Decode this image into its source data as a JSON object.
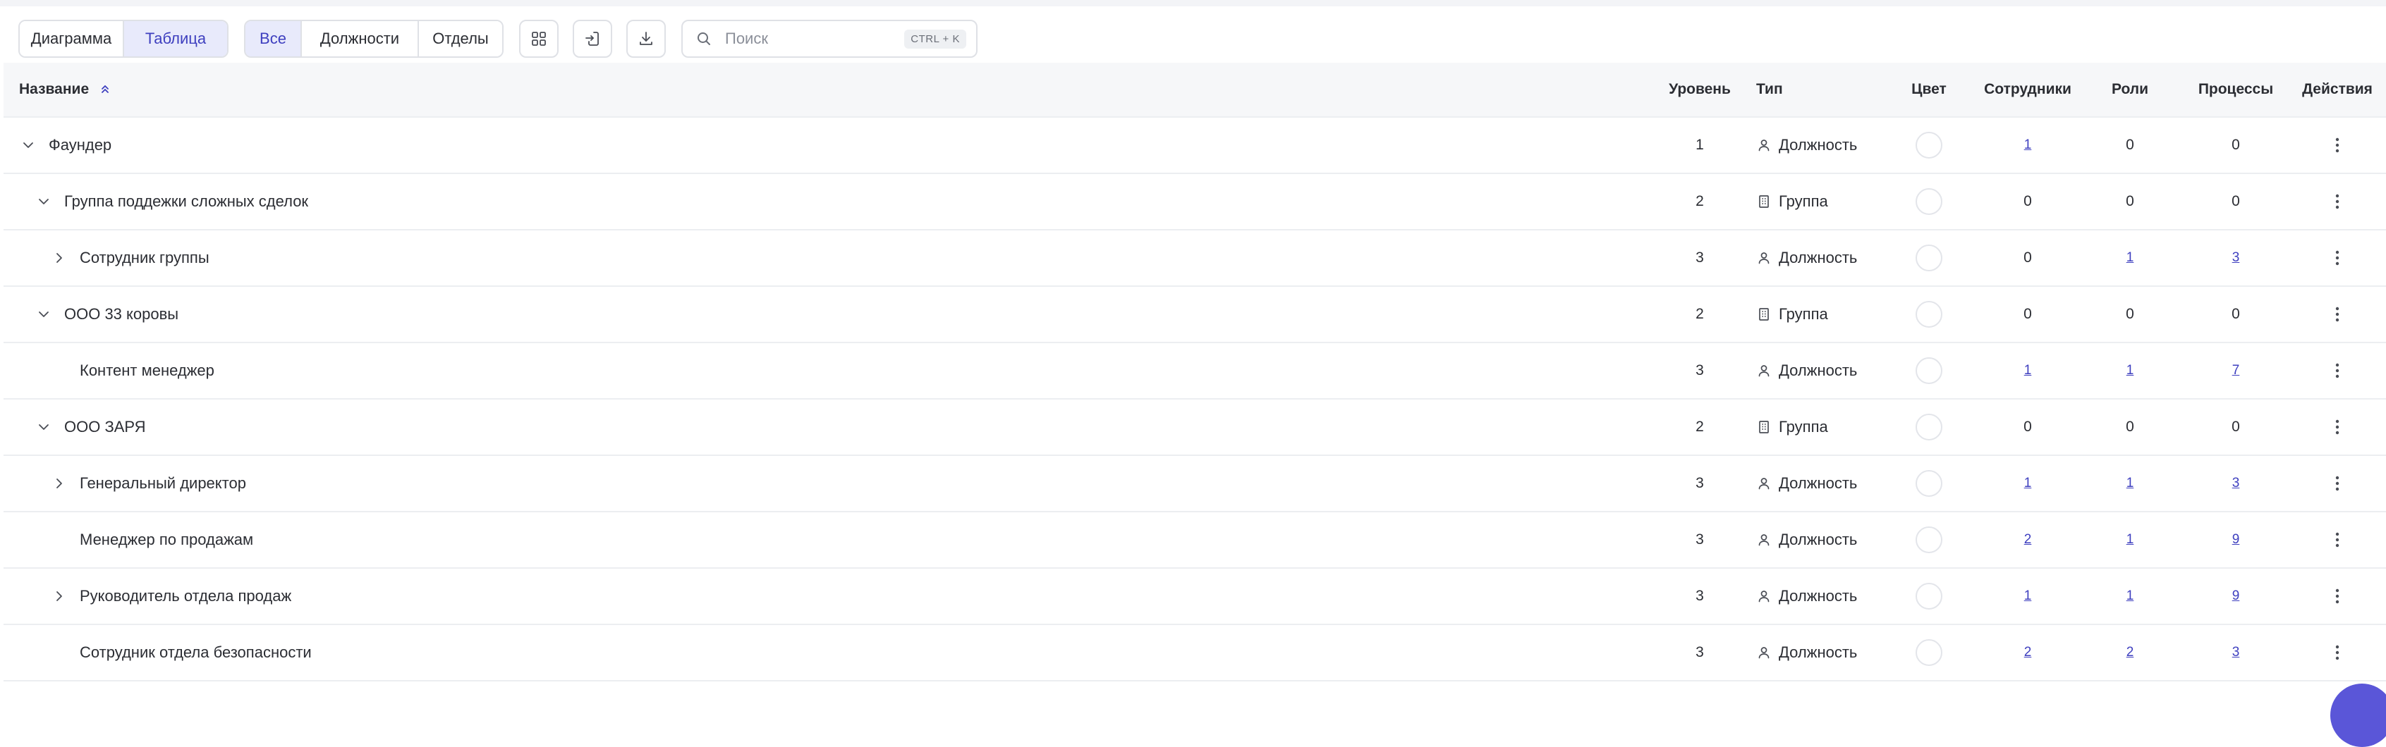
{
  "toolbar": {
    "view_tabs": [
      {
        "label": "Диаграмма",
        "active": false
      },
      {
        "label": "Таблица",
        "active": true
      }
    ],
    "filter_tabs": [
      {
        "label": "Все",
        "active": true
      },
      {
        "label": "Должности",
        "active": false
      },
      {
        "label": "Отделы",
        "active": false
      }
    ],
    "icon_buttons": [
      "grid-icon",
      "import-icon",
      "download-icon"
    ],
    "search": {
      "placeholder": "Поиск",
      "value": "",
      "shortcut": "CTRL + K"
    }
  },
  "table": {
    "columns": {
      "name": "Название",
      "level": "Уровень",
      "type": "Тип",
      "color": "Цвет",
      "employees": "Сотрудники",
      "roles": "Роли",
      "processes": "Процессы",
      "actions": "Действия"
    },
    "sort": {
      "column": "name",
      "direction": "asc"
    },
    "rows": [
      {
        "name": "Фаундер",
        "indent": 0,
        "toggle": "expanded",
        "level": "1",
        "type": "Должность",
        "type_icon": "person-icon",
        "employees": "1",
        "employees_link": true,
        "roles": "0",
        "roles_link": false,
        "processes": "0",
        "processes_link": false
      },
      {
        "name": "Группа поддежки сложных сделок",
        "indent": 1,
        "toggle": "expanded",
        "level": "2",
        "type": "Группа",
        "type_icon": "building-icon",
        "employees": "0",
        "employees_link": false,
        "roles": "0",
        "roles_link": false,
        "processes": "0",
        "processes_link": false
      },
      {
        "name": "Сотрудник группы",
        "indent": 2,
        "toggle": "collapsed",
        "level": "3",
        "type": "Должность",
        "type_icon": "person-icon",
        "employees": "0",
        "employees_link": false,
        "roles": "1",
        "roles_link": true,
        "processes": "3",
        "processes_link": true
      },
      {
        "name": "ООО 33 коровы",
        "indent": 1,
        "toggle": "expanded",
        "level": "2",
        "type": "Группа",
        "type_icon": "building-icon",
        "employees": "0",
        "employees_link": false,
        "roles": "0",
        "roles_link": false,
        "processes": "0",
        "processes_link": false
      },
      {
        "name": "Контент менеджер",
        "indent": 2,
        "toggle": "none",
        "level": "3",
        "type": "Должность",
        "type_icon": "person-icon",
        "employees": "1",
        "employees_link": true,
        "roles": "1",
        "roles_link": true,
        "processes": "7",
        "processes_link": true
      },
      {
        "name": "ООО ЗАРЯ",
        "indent": 1,
        "toggle": "expanded",
        "level": "2",
        "type": "Группа",
        "type_icon": "building-icon",
        "employees": "0",
        "employees_link": false,
        "roles": "0",
        "roles_link": false,
        "processes": "0",
        "processes_link": false
      },
      {
        "name": "Генеральный директор",
        "indent": 2,
        "toggle": "collapsed",
        "level": "3",
        "type": "Должность",
        "type_icon": "person-icon",
        "employees": "1",
        "employees_link": true,
        "roles": "1",
        "roles_link": true,
        "processes": "3",
        "processes_link": true
      },
      {
        "name": "Менеджер по продажам",
        "indent": 2,
        "toggle": "none",
        "level": "3",
        "type": "Должность",
        "type_icon": "person-icon",
        "employees": "2",
        "employees_link": true,
        "roles": "1",
        "roles_link": true,
        "processes": "9",
        "processes_link": true
      },
      {
        "name": "Руководитель отдела продаж",
        "indent": 2,
        "toggle": "collapsed",
        "level": "3",
        "type": "Должность",
        "type_icon": "person-icon",
        "employees": "1",
        "employees_link": true,
        "roles": "1",
        "roles_link": true,
        "processes": "9",
        "processes_link": true
      },
      {
        "name": "Сотрудник отдела безопасности",
        "indent": 2,
        "toggle": "none",
        "level": "3",
        "type": "Должность",
        "type_icon": "person-icon",
        "employees": "2",
        "employees_link": true,
        "roles": "2",
        "roles_link": true,
        "processes": "3",
        "processes_link": true
      }
    ]
  },
  "colors": {
    "accent": "#3e3fbf",
    "accent_bg": "#e8eafb",
    "fab": "#5a56d8",
    "border": "#dfe1e6"
  }
}
